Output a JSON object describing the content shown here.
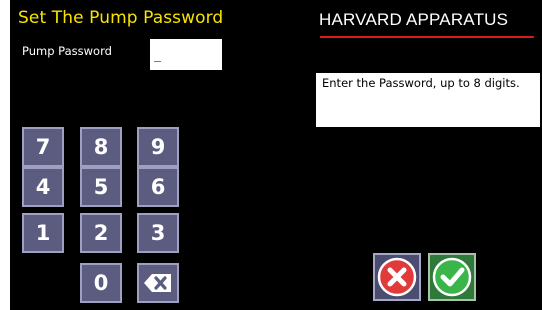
{
  "header": {
    "title": "Set The Pump Password",
    "brand": "HARVARD APPARATUS"
  },
  "password": {
    "label": "Pump Password",
    "value": "_"
  },
  "message": {
    "text": "Enter the Password, up to 8 digits."
  },
  "keypad": {
    "keys": [
      "7",
      "8",
      "9",
      "4",
      "5",
      "6",
      "1",
      "2",
      "3",
      "0"
    ],
    "backspace_icon": "backspace-icon"
  },
  "actions": {
    "cancel_icon": "cancel-x-icon",
    "confirm_icon": "check-icon"
  },
  "colors": {
    "background": "#000000",
    "title": "#f7e400",
    "brand_underline": "#d91a1a",
    "key_face": "#5b5c80",
    "cancel_red": "#e03a3a",
    "confirm_green": "#39b54a"
  }
}
